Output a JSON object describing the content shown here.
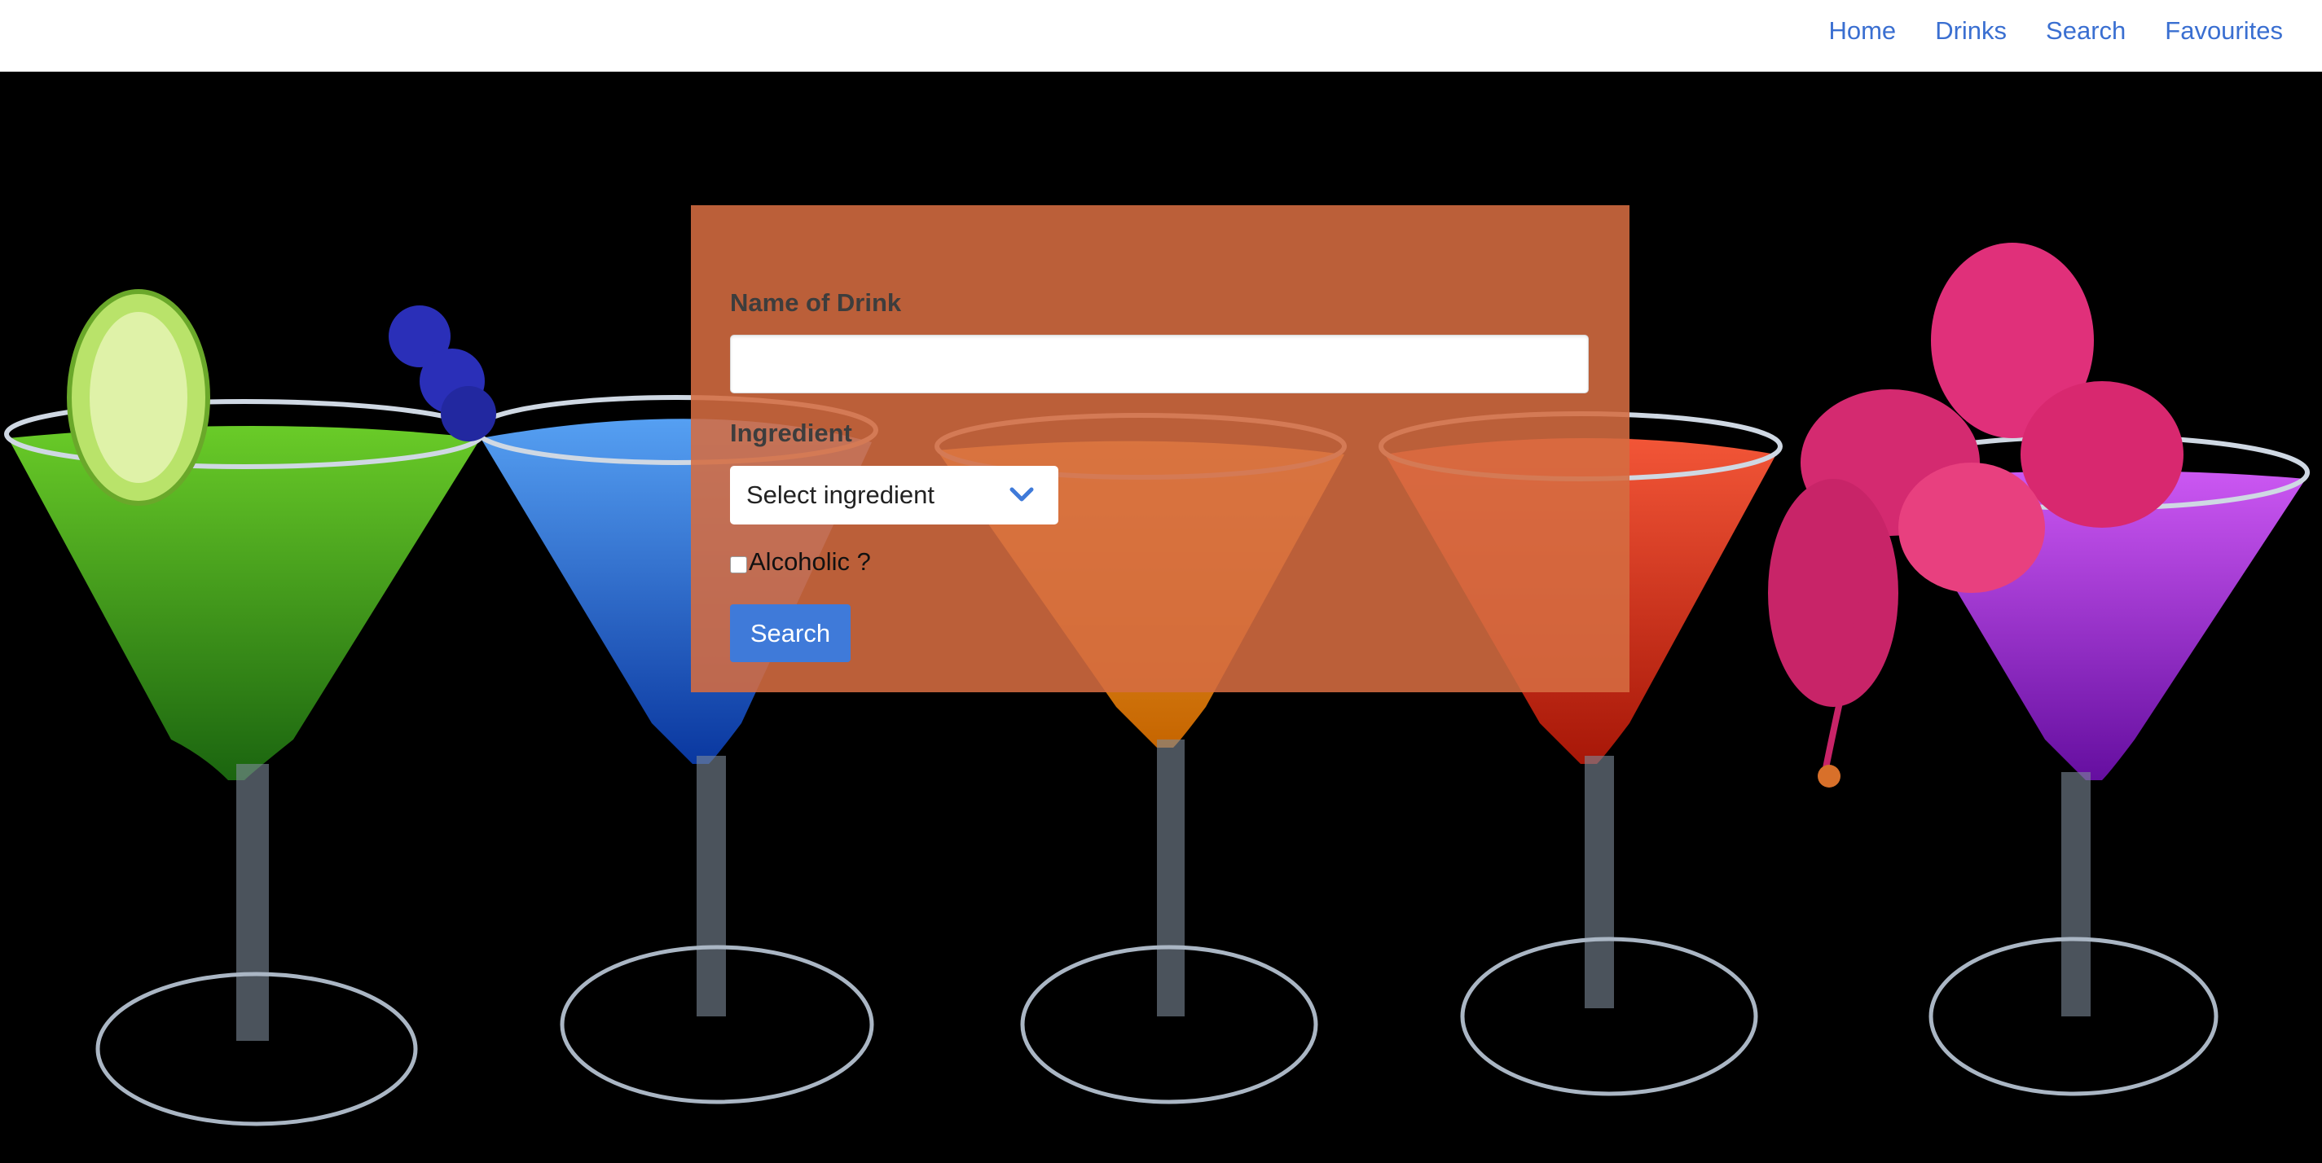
{
  "nav": {
    "links": [
      "Home",
      "Drinks",
      "Search",
      "Favourites"
    ]
  },
  "form": {
    "name_label": "Name of Drink",
    "name_value": "",
    "ingredient_label": "Ingredient",
    "ingredient_selected": "Select ingredient",
    "alcoholic_label": "Alcoholic ?",
    "alcoholic_checked": false,
    "search_label": "Search"
  },
  "colors": {
    "link": "#3a6fd1",
    "panel": "#d56c41",
    "button": "#3f7ad9",
    "background": "#000000"
  },
  "hero": {
    "image_subject": "five martini glasses with green, blue, orange, red and purple drinks on black background"
  }
}
